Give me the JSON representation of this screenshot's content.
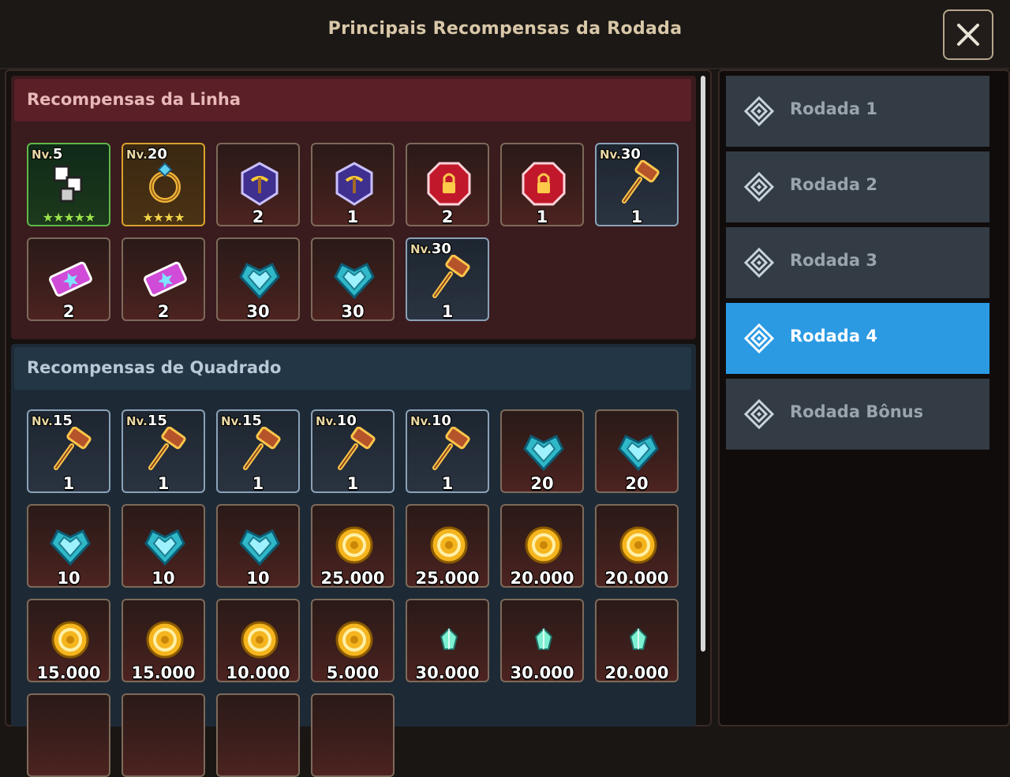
{
  "title": "Principais Recompensas da Rodada",
  "sections": {
    "line": {
      "title": "Recompensas da Linha",
      "items": [
        {
          "icon": "rune-icon",
          "level_prefix": "Nv.",
          "level": "5",
          "stars": "★★★★★",
          "qty": "",
          "frame": "green"
        },
        {
          "icon": "ring-icon",
          "level_prefix": "Nv.",
          "level": "20",
          "stars": "★★★★",
          "qty": "",
          "frame": "gold"
        },
        {
          "icon": "blue-pickaxe-gem-icon",
          "level_prefix": "",
          "level": "",
          "stars": "",
          "qty": "2",
          "frame": "normal"
        },
        {
          "icon": "blue-pickaxe-gem-icon",
          "level_prefix": "",
          "level": "",
          "stars": "",
          "qty": "1",
          "frame": "normal"
        },
        {
          "icon": "red-lock-gem-icon",
          "level_prefix": "",
          "level": "",
          "stars": "",
          "qty": "2",
          "frame": "normal"
        },
        {
          "icon": "red-lock-gem-icon",
          "level_prefix": "",
          "level": "",
          "stars": "",
          "qty": "1",
          "frame": "normal"
        },
        {
          "icon": "hammer-icon",
          "level_prefix": "Nv.",
          "level": "30",
          "stars": "",
          "qty": "1",
          "frame": "steel"
        },
        {
          "icon": "ticket-icon",
          "level_prefix": "",
          "level": "",
          "stars": "",
          "qty": "2",
          "frame": "normal"
        },
        {
          "icon": "ticket-icon",
          "level_prefix": "",
          "level": "",
          "stars": "",
          "qty": "2",
          "frame": "normal"
        },
        {
          "icon": "heart-crystal-icon",
          "level_prefix": "",
          "level": "",
          "stars": "",
          "qty": "30",
          "frame": "normal"
        },
        {
          "icon": "heart-crystal-icon",
          "level_prefix": "",
          "level": "",
          "stars": "",
          "qty": "30",
          "frame": "normal"
        },
        {
          "icon": "hammer-icon",
          "level_prefix": "Nv.",
          "level": "30",
          "stars": "",
          "qty": "1",
          "frame": "steel"
        }
      ]
    },
    "square": {
      "title": "Recompensas de Quadrado",
      "items": [
        {
          "icon": "hammer-icon",
          "level_prefix": "Nv.",
          "level": "15",
          "qty": "1",
          "frame": "steel"
        },
        {
          "icon": "hammer-icon",
          "level_prefix": "Nv.",
          "level": "15",
          "qty": "1",
          "frame": "steel"
        },
        {
          "icon": "hammer-icon",
          "level_prefix": "Nv.",
          "level": "15",
          "qty": "1",
          "frame": "steel"
        },
        {
          "icon": "hammer-icon",
          "level_prefix": "Nv.",
          "level": "10",
          "qty": "1",
          "frame": "steel"
        },
        {
          "icon": "hammer-icon",
          "level_prefix": "Nv.",
          "level": "10",
          "qty": "1",
          "frame": "steel"
        },
        {
          "icon": "heart-crystal-icon",
          "level_prefix": "",
          "level": "",
          "qty": "20",
          "frame": "normal"
        },
        {
          "icon": "heart-crystal-icon",
          "level_prefix": "",
          "level": "",
          "qty": "20",
          "frame": "normal"
        },
        {
          "icon": "heart-crystal-icon",
          "level_prefix": "",
          "level": "",
          "qty": "10",
          "frame": "normal"
        },
        {
          "icon": "heart-crystal-icon",
          "level_prefix": "",
          "level": "",
          "qty": "10",
          "frame": "normal"
        },
        {
          "icon": "heart-crystal-icon",
          "level_prefix": "",
          "level": "",
          "qty": "10",
          "frame": "normal"
        },
        {
          "icon": "gold-coin-icon",
          "level_prefix": "",
          "level": "",
          "qty": "25.000",
          "frame": "normal"
        },
        {
          "icon": "gold-coin-icon",
          "level_prefix": "",
          "level": "",
          "qty": "25.000",
          "frame": "normal"
        },
        {
          "icon": "gold-coin-icon",
          "level_prefix": "",
          "level": "",
          "qty": "20.000",
          "frame": "normal"
        },
        {
          "icon": "gold-coin-icon",
          "level_prefix": "",
          "level": "",
          "qty": "20.000",
          "frame": "normal"
        },
        {
          "icon": "gold-coin-icon",
          "level_prefix": "",
          "level": "",
          "qty": "15.000",
          "frame": "normal"
        },
        {
          "icon": "gold-coin-icon",
          "level_prefix": "",
          "level": "",
          "qty": "15.000",
          "frame": "normal"
        },
        {
          "icon": "gold-coin-icon",
          "level_prefix": "",
          "level": "",
          "qty": "10.000",
          "frame": "normal"
        },
        {
          "icon": "gold-coin-icon",
          "level_prefix": "",
          "level": "",
          "qty": "5.000",
          "frame": "normal"
        },
        {
          "icon": "small-crystal-icon",
          "level_prefix": "",
          "level": "",
          "qty": "30.000",
          "frame": "normal"
        },
        {
          "icon": "small-crystal-icon",
          "level_prefix": "",
          "level": "",
          "qty": "30.000",
          "frame": "normal"
        },
        {
          "icon": "small-crystal-icon",
          "level_prefix": "",
          "level": "",
          "qty": "20.000",
          "frame": "normal"
        },
        {
          "icon": "",
          "level_prefix": "",
          "level": "",
          "qty": "",
          "frame": "normal"
        },
        {
          "icon": "",
          "level_prefix": "",
          "level": "",
          "qty": "",
          "frame": "normal"
        },
        {
          "icon": "",
          "level_prefix": "",
          "level": "",
          "qty": "",
          "frame": "normal"
        },
        {
          "icon": "",
          "level_prefix": "",
          "level": "",
          "qty": "",
          "frame": "normal"
        }
      ]
    }
  },
  "rounds": [
    {
      "label": "Rodada 1",
      "active": false
    },
    {
      "label": "Rodada 2",
      "active": false
    },
    {
      "label": "Rodada 3",
      "active": false
    },
    {
      "label": "Rodada 4",
      "active": true
    },
    {
      "label": "Rodada Bônus",
      "active": false
    }
  ],
  "colors": {
    "active_tab": "#2b9ae3",
    "inactive_tab": "#333c44",
    "line_section": "#5a1f27",
    "square_section": "#233645"
  }
}
